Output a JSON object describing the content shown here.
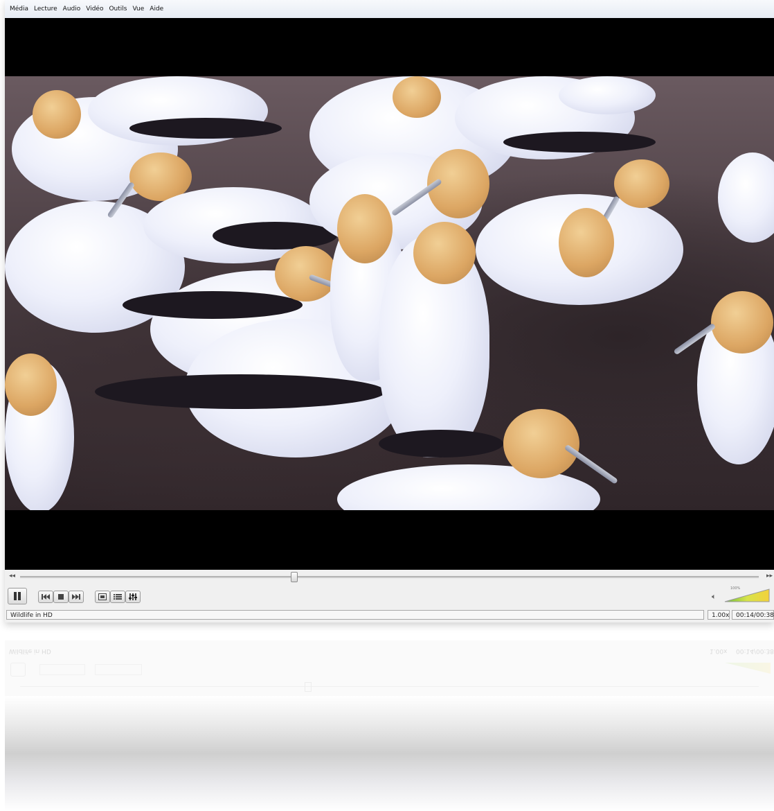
{
  "menubar": {
    "items": [
      "Média",
      "Lecture",
      "Audio",
      "Vidéo",
      "Outils",
      "Vue",
      "Aide"
    ]
  },
  "video": {
    "subject": "gannet-colony"
  },
  "seek": {
    "position_fraction": 0.37,
    "left_arrow": "◂◂",
    "right_arrow": "▸▸"
  },
  "controls": {
    "icons": {
      "pause": "pause-icon",
      "prev": "skip-back-icon",
      "stop": "stop-icon",
      "next": "skip-forward-icon",
      "fullscreen": "fullscreen-icon",
      "playlist": "playlist-icon",
      "equalizer": "equalizer-icon",
      "volume": "speaker-icon"
    },
    "volume_percent_label": "100%",
    "volume_fraction": 1.0
  },
  "status": {
    "title": "Wildlife in HD",
    "speed": "1.00x",
    "time": "00:14/00:38"
  },
  "reflection": {
    "title": "Wildlife in HD",
    "speed": "1.00x",
    "time": "00:14/00:38"
  },
  "colors": {
    "accent_green": "#8bc34a",
    "volume_yellow": "#f0d040"
  }
}
